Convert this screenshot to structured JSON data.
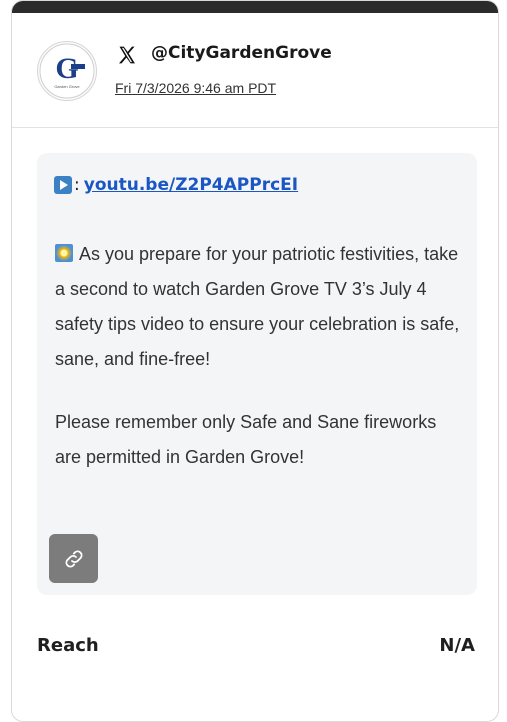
{
  "post": {
    "handle": "@CityGardenGrove",
    "date": "Fri 7/3/2026 9:46 am PDT",
    "avatar_text": "Garden Grove",
    "link_prefix": ":",
    "link_text": "youtu.be/Z2P4APPrcEI",
    "paragraph1": "As you prepare for your patriotic festivities, take a second to watch Garden Grove TV 3’s July 4 safety tips video to ensure your celebration is safe, sane, and fine-free!",
    "paragraph2": "Please remember only Safe and Sane fireworks are permitted in Garden Grove!"
  },
  "stats": {
    "reach_label": "Reach",
    "reach_value": "N/A"
  },
  "colors": {
    "top_bar": "#2b2b2b",
    "link": "#1a56c4",
    "body_bg": "#f4f5f7",
    "link_button": "#7c7c7c"
  },
  "icons": [
    "x-logo-icon",
    "play-button-icon",
    "sparkler-emoji-icon",
    "link-icon"
  ]
}
